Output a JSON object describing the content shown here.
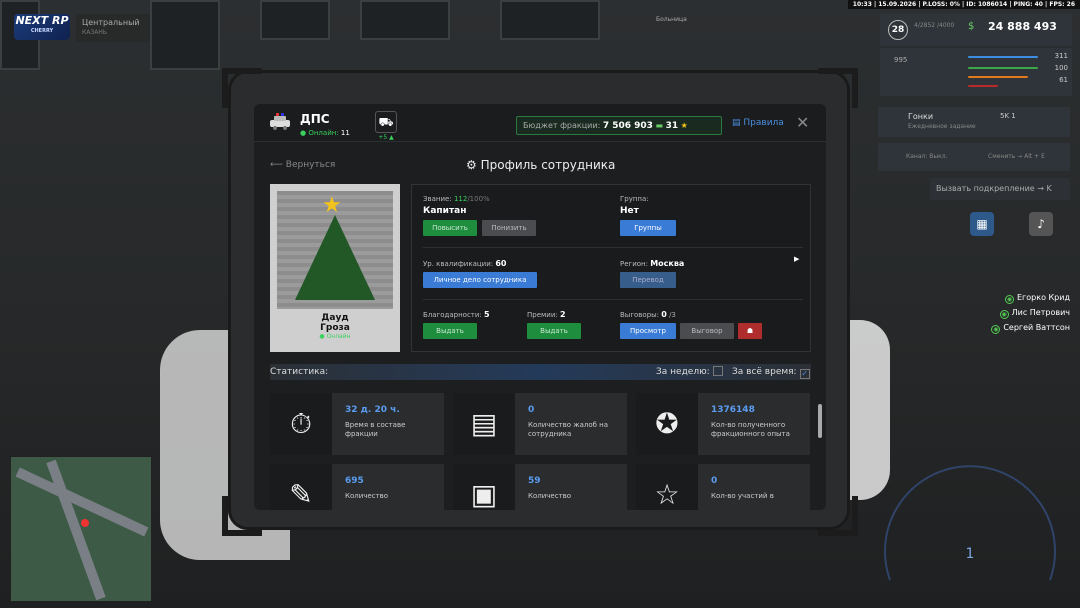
{
  "hud": {
    "status_line": "10:33 | 15.09.2026 | P.LOSS: 0% | ID: 1086014 | PING: 40 | FPS: 26",
    "logo_text": "NEXT RP",
    "logo_sub": "CHERRY",
    "location": "Центральный",
    "location_sub": "КАЗАНЬ",
    "sign": "Больница",
    "level": "28",
    "exp_text": "4/2852 /4000",
    "money": "24 888 493",
    "armor": "995",
    "bar1": "311",
    "bar2": "100",
    "bar3": "61",
    "race_title": "Гонки",
    "race_sub": "Ежедневное задание",
    "race_reward": "5K 1",
    "channel": "Канал: Выкл.",
    "channel_switch": "Сменить → Alt + E",
    "backup": "Вызвать подкрепление → K",
    "speed": "1"
  },
  "players": [
    "Егорко Крид",
    "Лис Петрович",
    "Сергей Ваттсон"
  ],
  "header": {
    "faction": "ДПС",
    "online_label": "Онлайн:",
    "online_count": "11",
    "cart_badge": "+5 ▲",
    "budget_label": "Бюджет фракции:",
    "budget_value": "7 506 903",
    "stars": "31",
    "rules": "Правила"
  },
  "page": {
    "back": "Вернуться",
    "title": "Профиль сотрудника"
  },
  "employee": {
    "first_name": "Дауд",
    "last_name": "Гроза",
    "status": "Онлайн",
    "rank_label": "Звание:",
    "rank_value": "112",
    "rank_max": "/100%",
    "rank_name": "Капитан",
    "group_label": "Группа:",
    "group_value": "Нет",
    "qual_label": "Ур. квалификации:",
    "qual_value": "60",
    "region_label": "Регион:",
    "region_value": "Москва",
    "thanks_label": "Благодарности:",
    "thanks_value": "5",
    "bonus_label": "Премии:",
    "bonus_value": "2",
    "reprimand_label": "Выговоры:",
    "reprimand_value": "0",
    "reprimand_max": " /3"
  },
  "actions": {
    "promote": "Повысить",
    "demote": "Понизить",
    "groups": "Группы",
    "personal_file": "Личное дело сотрудника",
    "transfer": "Перевод",
    "give": "Выдать",
    "view": "Просмотр",
    "reprimand": "Выговор"
  },
  "stats": {
    "title": "Статистика:",
    "week": "За неделю:",
    "all_time": "За всё время:",
    "cards": [
      {
        "value": "32 д. 20 ч.",
        "label": "Время в составе фракции"
      },
      {
        "value": "0",
        "label": "Количество жалоб на сотрудника"
      },
      {
        "value": "1376148",
        "label": "Кол-во полученного фракционного опыта"
      },
      {
        "value": "695",
        "label": "Количество"
      },
      {
        "value": "59",
        "label": "Количество"
      },
      {
        "value": "0",
        "label": "Кол-во участий в"
      }
    ]
  },
  "colors": {
    "accent_blue": "#3a7bd5",
    "accent_green": "#1e8e3e",
    "online_green": "#3ad15d",
    "danger_red": "#b02d2d",
    "star_gold": "#f3c31d"
  }
}
